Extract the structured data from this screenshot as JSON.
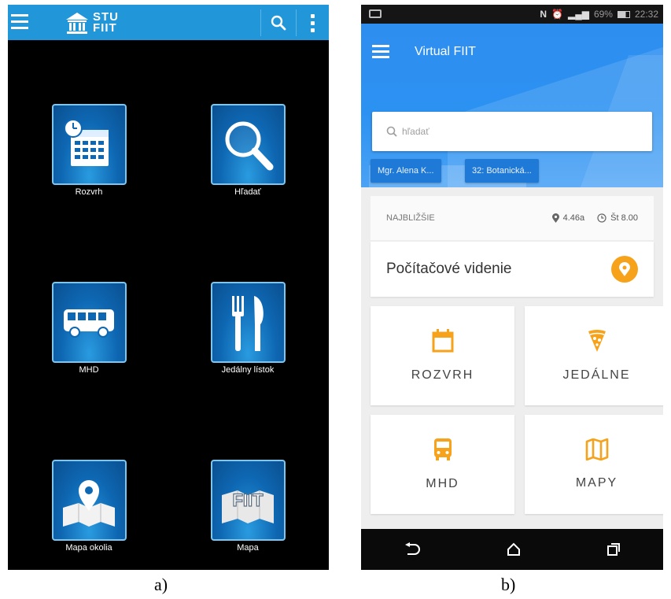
{
  "screen_a": {
    "header": {
      "logo_text_line1": "STU",
      "logo_text_line2": "FIIT"
    },
    "tiles": [
      {
        "label": "Rozvrh",
        "icon": "calendar-clock-icon"
      },
      {
        "label": "Hľadať",
        "icon": "magnifier-icon"
      },
      {
        "label": "MHD",
        "icon": "bus-icon"
      },
      {
        "label": "Jedálny lístok",
        "icon": "fork-knife-icon"
      },
      {
        "label": "Mapa okolia",
        "icon": "map-pin-icon"
      },
      {
        "label": "Mapa",
        "icon": "fiit-map-icon",
        "icon_text": "FIIT"
      }
    ]
  },
  "screen_b": {
    "status_bar": {
      "battery": "69%",
      "time": "22:32"
    },
    "app_title": "Virtual FIIT",
    "search": {
      "placeholder": "hľadať"
    },
    "chips": [
      "Mgr. Alena K...",
      "32: Botanická..."
    ],
    "nearest": {
      "label": "NAJBLIŽŠIE",
      "room": "4.46a",
      "time": "Št 8.00"
    },
    "course": {
      "name": "Počítačové videnie"
    },
    "cards": [
      {
        "label": "ROZVRH",
        "icon": "calendar-icon"
      },
      {
        "label": "JEDÁLNE",
        "icon": "pizza-icon"
      },
      {
        "label": "MHD",
        "icon": "bus-icon"
      },
      {
        "label": "MAPY",
        "icon": "map-icon"
      }
    ],
    "accent_color": "#f7a21b",
    "primary_color": "#2e8ef0"
  },
  "captions": {
    "a": "a)",
    "b": "b)"
  }
}
